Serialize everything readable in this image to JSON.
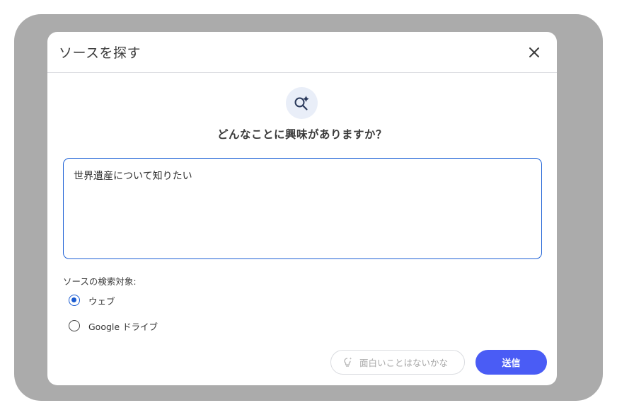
{
  "dialog": {
    "title": "ソースを探す",
    "close_icon": "close-icon",
    "hero_icon": "search-sparkle-icon",
    "question": "どんなことに興味がありますか？",
    "query_value": "世界遺産について知りたい",
    "search_target_label": "ソースの検索対象:",
    "options": [
      {
        "label": "ウェブ",
        "selected": true
      },
      {
        "label": "Google ドライブ",
        "selected": false
      }
    ],
    "suggest_icon": "lightbulb-icon",
    "suggest_label": "面白いことはないかな",
    "send_label": "送信",
    "colors": {
      "accent": "#4a5cf5",
      "focus_border": "#1f62d6",
      "radio_selected": "#1a5bd0",
      "backdrop": "#ababab"
    }
  }
}
